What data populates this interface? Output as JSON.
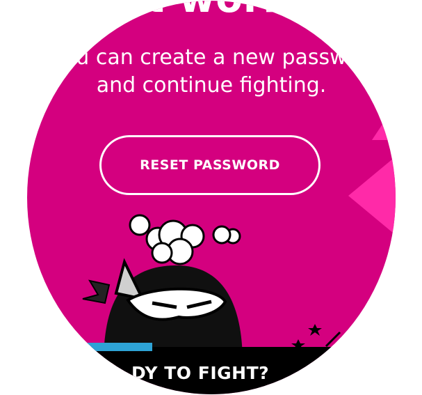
{
  "colors": {
    "background": "#ffffff",
    "circle": "#d4007f",
    "accent_triangle": "#ff2aa8",
    "bar": "#000000",
    "bar_accent": "#2ea3d6",
    "text": "#ffffff"
  },
  "header": {
    "title_fragment": "t worl"
  },
  "message": {
    "line1": "u can create a new passw",
    "line2": "and continue fighting."
  },
  "reset_button": {
    "label": "RESET PASSWORD"
  },
  "footer": {
    "cta_fragment": "DY TO FIGHT?"
  },
  "illustration": {
    "character": "ninja-icon",
    "effect": "dust-cloud-icon",
    "decoration": "stars-icon"
  }
}
